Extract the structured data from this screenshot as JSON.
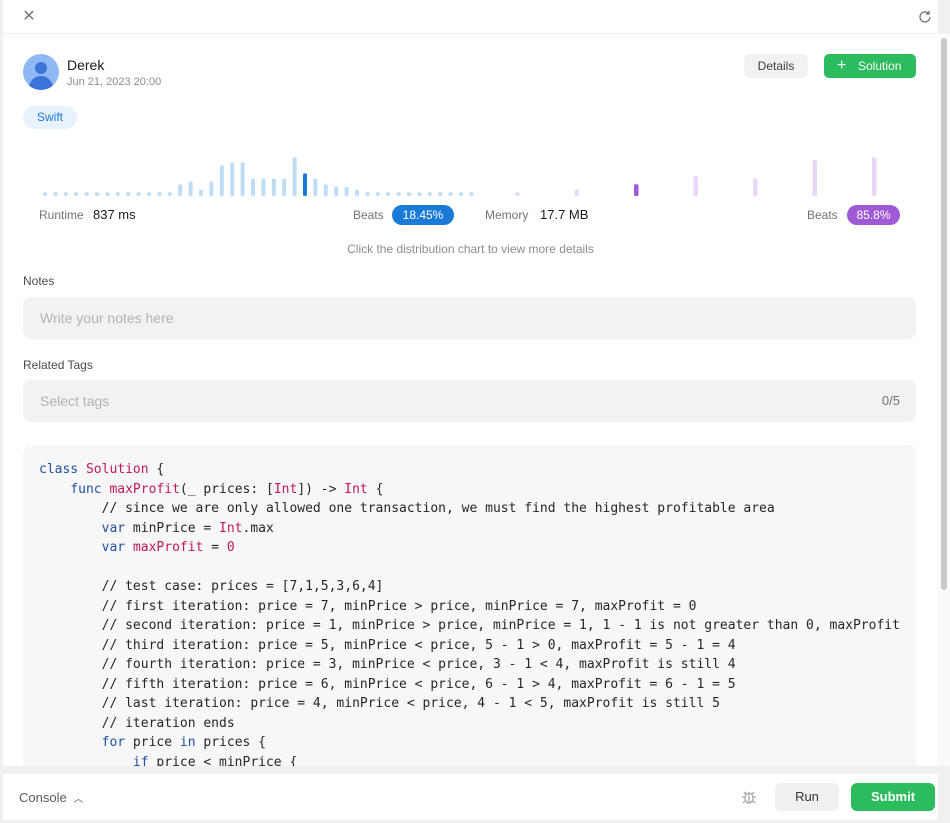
{
  "header": {
    "close_icon": "close-icon",
    "refresh_icon": "refresh-icon"
  },
  "submission": {
    "username": "Derek",
    "date": "Jun 21, 2023 20:00",
    "details_label": "Details",
    "solution_label": "Solution",
    "language": "Swift"
  },
  "stats": {
    "runtime_label": "Runtime",
    "runtime_value": "837 ms",
    "runtime_beats_label": "Beats",
    "runtime_beats": "18.45%",
    "memory_label": "Memory",
    "memory_value": "17.7 MB",
    "memory_beats_label": "Beats",
    "memory_beats": "85.8%",
    "hint": "Click the distribution chart to view more details",
    "colors": {
      "runtime_accent": "#1a7ad8",
      "memory_accent": "#a05ad6",
      "runtime_bar": "#bfdcf7",
      "memory_bar": "#ead7f8"
    }
  },
  "chart_data": [
    {
      "type": "bar",
      "name": "runtime-distribution",
      "values": [
        1,
        1,
        1,
        1,
        1,
        1,
        1,
        1,
        1,
        1,
        1,
        1,
        1,
        4,
        5,
        2,
        5,
        11,
        12,
        12,
        6,
        6,
        6,
        6,
        14,
        8,
        6,
        4,
        3,
        3,
        2,
        1,
        1,
        1,
        1,
        1,
        1,
        1,
        1,
        1,
        1,
        1
      ],
      "highlight_index": 25
    },
    {
      "type": "bar",
      "name": "memory-distribution",
      "values": [
        1,
        2,
        4,
        7,
        6,
        13,
        14
      ],
      "highlight_index": 2
    }
  ],
  "notes": {
    "label": "Notes",
    "placeholder": "Write your notes here"
  },
  "tags": {
    "label": "Related Tags",
    "placeholder": "Select tags",
    "count": "0/5"
  },
  "code": {
    "lines": [
      "class Solution {",
      "    func maxProfit(_ prices: [Int]) -> Int {",
      "        // since we are only allowed one transaction, we must find the highest profitable area",
      "        var minPrice = Int.max",
      "        var maxProfit = 0",
      "",
      "        // test case: prices = [7,1,5,3,6,4]",
      "        // first iteration: price = 7, minPrice > price, minPrice = 7, maxProfit = 0",
      "        // second iteration: price = 1, minPrice > price, minPrice = 1, 1 - 1 is not greater than 0, maxProfit",
      "        // third iteration: price = 5, minPrice < price, 5 - 1 > 0, maxProfit = 5 - 1 = 4",
      "        // fourth iteration: price = 3, minPrice < price, 3 - 1 < 4, maxProfit is still 4",
      "        // fifth iteration: price = 6, minPrice < price, 6 - 1 > 4, maxProfit = 6 - 1 = 5",
      "        // last iteration: price = 4, minPrice < price, 4 - 1 < 5, maxProfit is still 5",
      "        // iteration ends",
      "        for price in prices {",
      "            if price < minPrice {"
    ]
  },
  "footer": {
    "console_label": "Console",
    "run_label": "Run",
    "submit_label": "Submit",
    "debug_icon": "bug-icon"
  }
}
